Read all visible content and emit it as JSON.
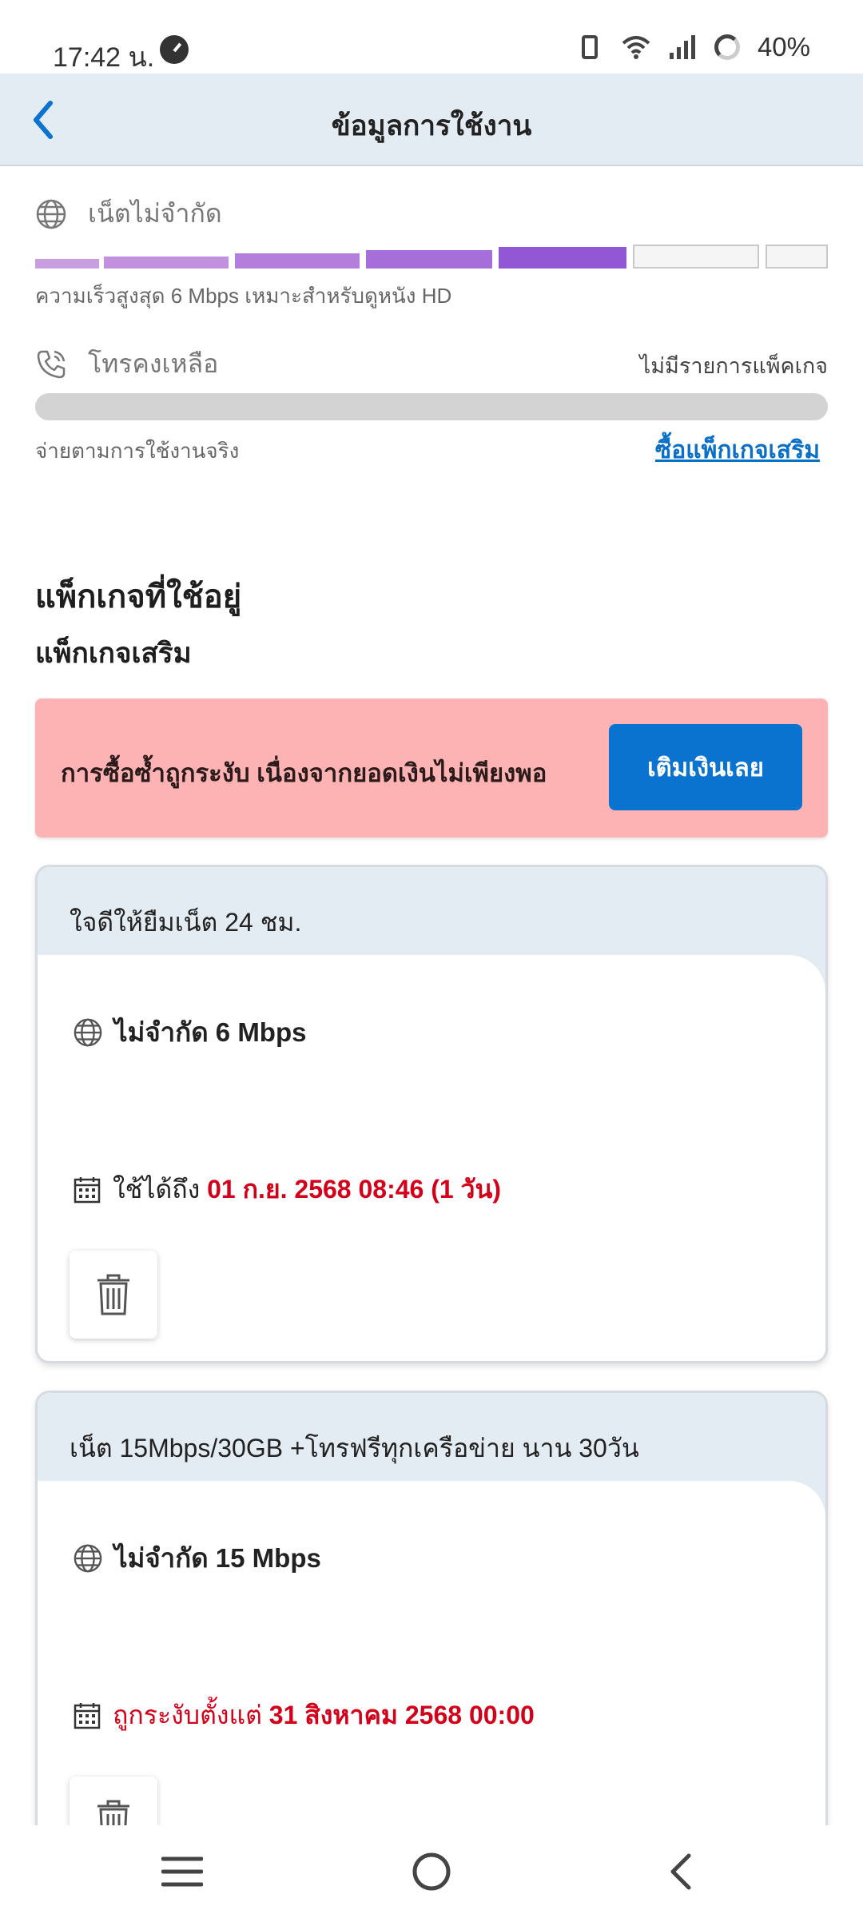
{
  "status_bar": {
    "time": "17:42 น.",
    "battery": "40%"
  },
  "header": {
    "title": "ข้อมูลการใช้งาน"
  },
  "internet": {
    "label": "เน็ตไม่จำกัด",
    "speed_level": "5 of 7 segments filled",
    "description": "ความเร็วสูงสุด 6 Mbps เหมาะสำหรับดูหนัง HD"
  },
  "calls": {
    "label": "โทรคงเหลือ",
    "status": "ไม่มีรายการแพ็คเกจ",
    "note": "จ่ายตามการใช้งานจริง",
    "buy_link": "ซื้อแพ็กเกจเสริม"
  },
  "section": {
    "title": "แพ็กเกจที่ใช้อยู่",
    "subtitle": "แพ็กเกจเสริม"
  },
  "alert": {
    "message": "การซื้อซ้ำถูกระงับ เนื่องจากยอดเงินไม่เพียงพอ",
    "button": "เติมเงินเลย",
    "color": "#fdb3b3"
  },
  "packages": [
    {
      "name": "ใจดีให้ยืมเน็ต 24 ชม.",
      "feature": "ไม่จำกัด 6 Mbps",
      "expiry_prefix": "ใช้ได้ถึง",
      "expiry_value": "01 ก.ย. 2568 08:46 (1 วัน)"
    },
    {
      "name": "เน็ต 15Mbps/30GB +โทรฟรีทุกเครือข่าย นาน 30วัน",
      "feature": "ไม่จำกัด 15 Mbps",
      "expiry_prefix": "ถูกระงับตั้งแต่",
      "expiry_value": "31 สิงหาคม 2568 00:00"
    }
  ],
  "colors": {
    "accent": "#0a72cf",
    "header_bg": "#e4ecf3",
    "warning_red": "#d4001a",
    "speed_purple": "#9b5fd6"
  },
  "icons": {
    "back": "chevron-left-icon",
    "globe": "globe-icon",
    "phone": "phone-icon",
    "calendar": "calendar-icon",
    "trash": "trash-icon"
  }
}
